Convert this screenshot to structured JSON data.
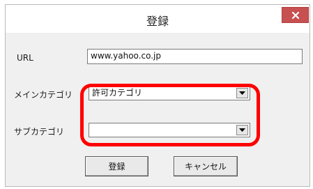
{
  "window": {
    "title": "登録",
    "close_label": "×"
  },
  "form": {
    "url_label": "URL",
    "url_value": "www.yahoo.co.jp",
    "main_category_label": "メインカテゴリ",
    "main_category_selected": "許可カテゴリ",
    "sub_category_label": "サブカテゴリ",
    "sub_category_selected": ""
  },
  "buttons": {
    "register_label": "登録",
    "cancel_label": "キャンセル"
  },
  "colors": {
    "highlight": "#ff0000",
    "close_button": "#c75050"
  },
  "icons": {
    "close": "close-icon",
    "dropdown": "chevron-down-icon"
  }
}
